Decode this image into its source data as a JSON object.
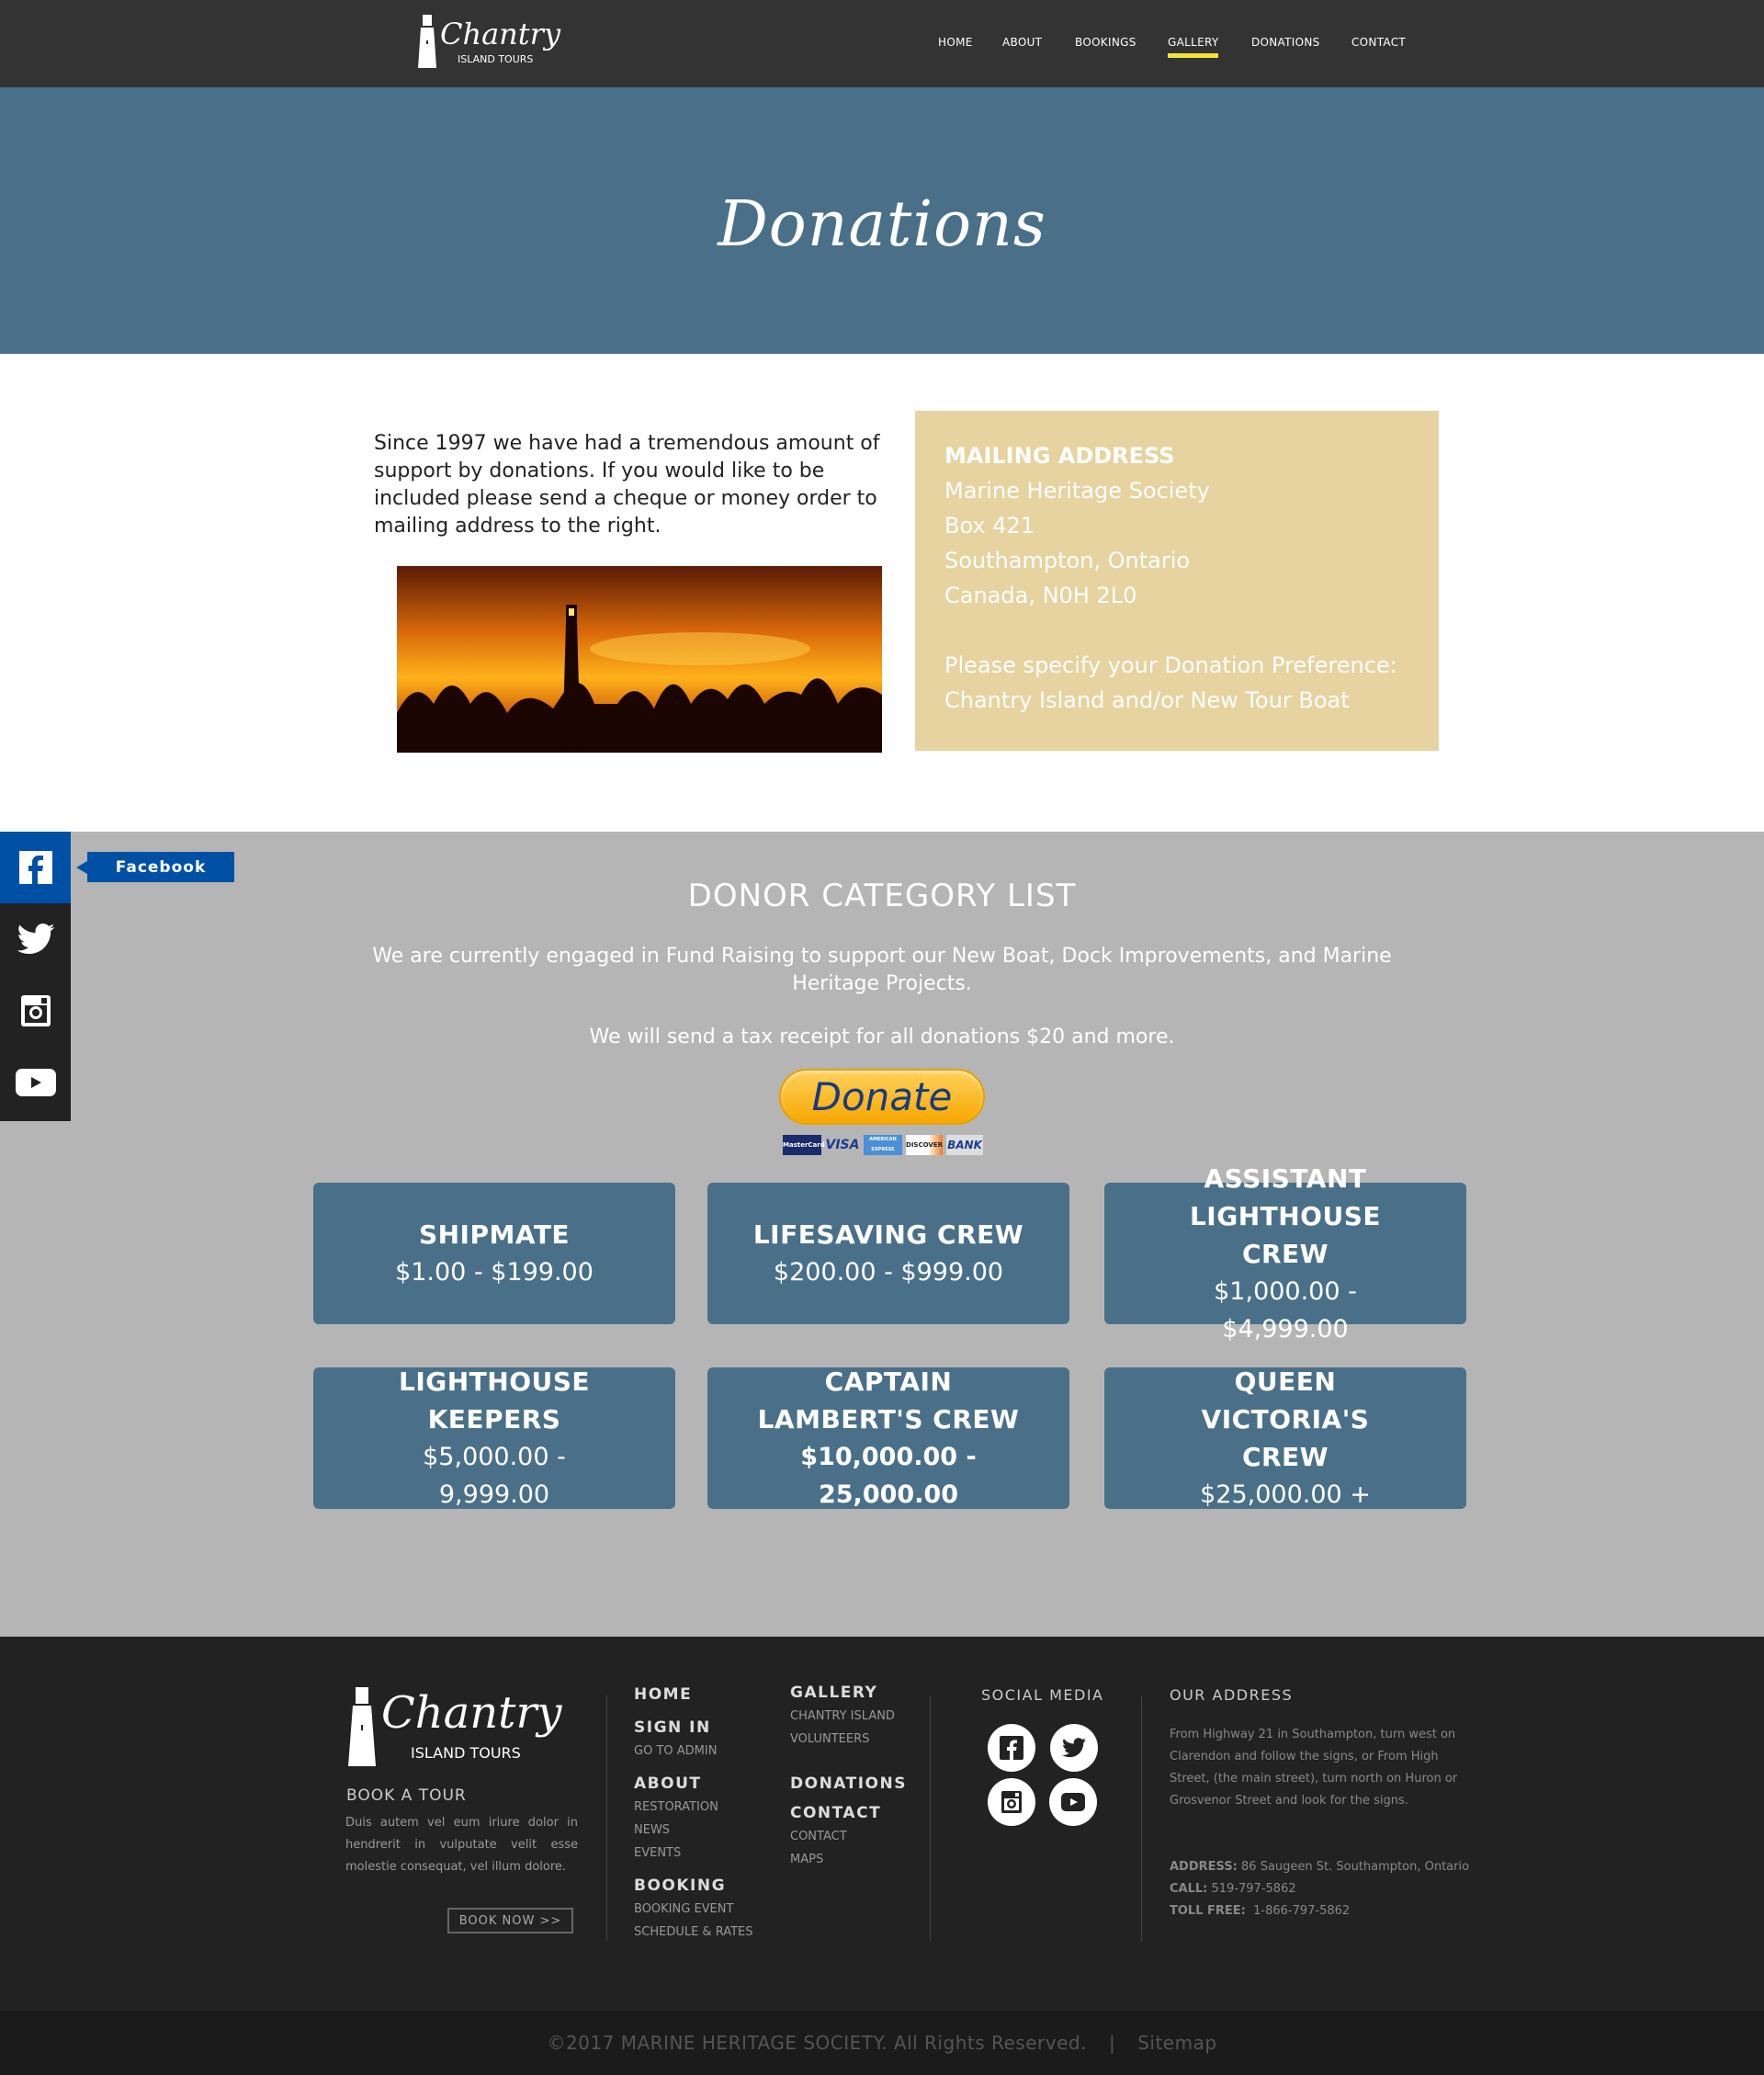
{
  "nav": {
    "logo_title": "Chantry",
    "logo_subtitle": "ISLAND TOURS",
    "items": [
      {
        "label": "HOME"
      },
      {
        "label": "ABOUT"
      },
      {
        "label": "BOOKINGS"
      },
      {
        "label": "GALLERY",
        "active": true
      },
      {
        "label": "DONATIONS"
      },
      {
        "label": "CONTACT"
      }
    ],
    "active_color": "#f2e33a"
  },
  "hero": {
    "title": "Donations",
    "color": "#4a7089"
  },
  "intro": {
    "text": "Since 1997 we have had a tremendous amount of support by donations. If you would like to be included please send a cheque or money order to mailing address to the right."
  },
  "mailing": {
    "heading": "MAILING ADDRESS",
    "lines": [
      "Marine Heritage Society",
      "Box 421",
      "Southampton, Ontario",
      "Canada, N0H 2L0"
    ],
    "pref_label": "Please specify your Donation Preference:",
    "pref_value": "Chantry Island and/or New Tour Boat"
  },
  "social_sidebar": {
    "tooltip": "Facebook"
  },
  "donor": {
    "heading": "DONOR CATEGORY LIST",
    "para1": "We are currently engaged in Fund Raising to support our New Boat, Dock Improvements, and Marine Heritage Projects.",
    "para2": "We will send a tax receipt for all donations $20 and more.",
    "donate_label": "Donate",
    "payment_cards": [
      "MasterCard",
      "VISA",
      "AMERICAN EXPRESS",
      "DISCOVER",
      "BANK"
    ],
    "categories": [
      {
        "title": "SHIPMATE",
        "range": "$1.00 - $199.00"
      },
      {
        "title": "LIFESAVING CREW",
        "range": "$200.00 - $999.00"
      },
      {
        "title": "ASSISTANT LIGHTHOUSE CREW",
        "range": "$1,000.00 - $4,999.00"
      },
      {
        "title": "LIGHTHOUSE KEEPERS",
        "range": "$5,000.00 - 9,999.00"
      },
      {
        "title": "CAPTAIN LAMBERT'S CREW",
        "range": "$10,000.00 - 25,000.00"
      },
      {
        "title": "QUEEN VICTORIA'S CREW",
        "range": "$25,000.00 +"
      }
    ]
  },
  "footer": {
    "book_heading": "BOOK A TOUR",
    "book_text": "Duis autem vel eum iriure dolor in hendrerit in vulputate velit esse molestie consequat, vel illum dolore.",
    "book_button": "BOOK NOW >>",
    "col1": {
      "home": "HOME",
      "signin": "SIGN IN",
      "goto_admin": "GO TO ADMIN",
      "about": "ABOUT",
      "restoration": "RESTORATION",
      "news": "NEWS",
      "events": "EVENTS",
      "booking": "BOOKING",
      "booking_event": "BOOKING EVENT",
      "schedule": "SCHEDULE & RATES"
    },
    "col2": {
      "gallery": "GALLERY",
      "chantry_island": "CHANTRY ISLAND",
      "volunteers": "VOLUNTEERS",
      "donations": "DONATIONS",
      "contact": "CONTACT",
      "contact_sub": "CONTACT",
      "maps": "MAPS"
    },
    "social_heading": "SOCIAL MEDIA",
    "address_heading": "OUR ADDRESS",
    "directions": "From Highway 21 in Southampton, turn west on Clarendon and follow the signs, or From High Street, (the main street), turn north on Huron or Grosvenor Street and look for the signs.",
    "address_label": "ADDRESS:",
    "address_value": "86 Saugeen St. Southampton, Ontario",
    "call_label": "CALL:",
    "call_value": "519-797-5862",
    "tollfree_label": "TOLL FREE:",
    "tollfree_value": "1-866-797-5862"
  },
  "bottom": {
    "copyright": "©2017 MARINE HERITAGE SOCIETY. All Rights Reserved.",
    "separator": "|",
    "sitemap": "Sitemap"
  }
}
